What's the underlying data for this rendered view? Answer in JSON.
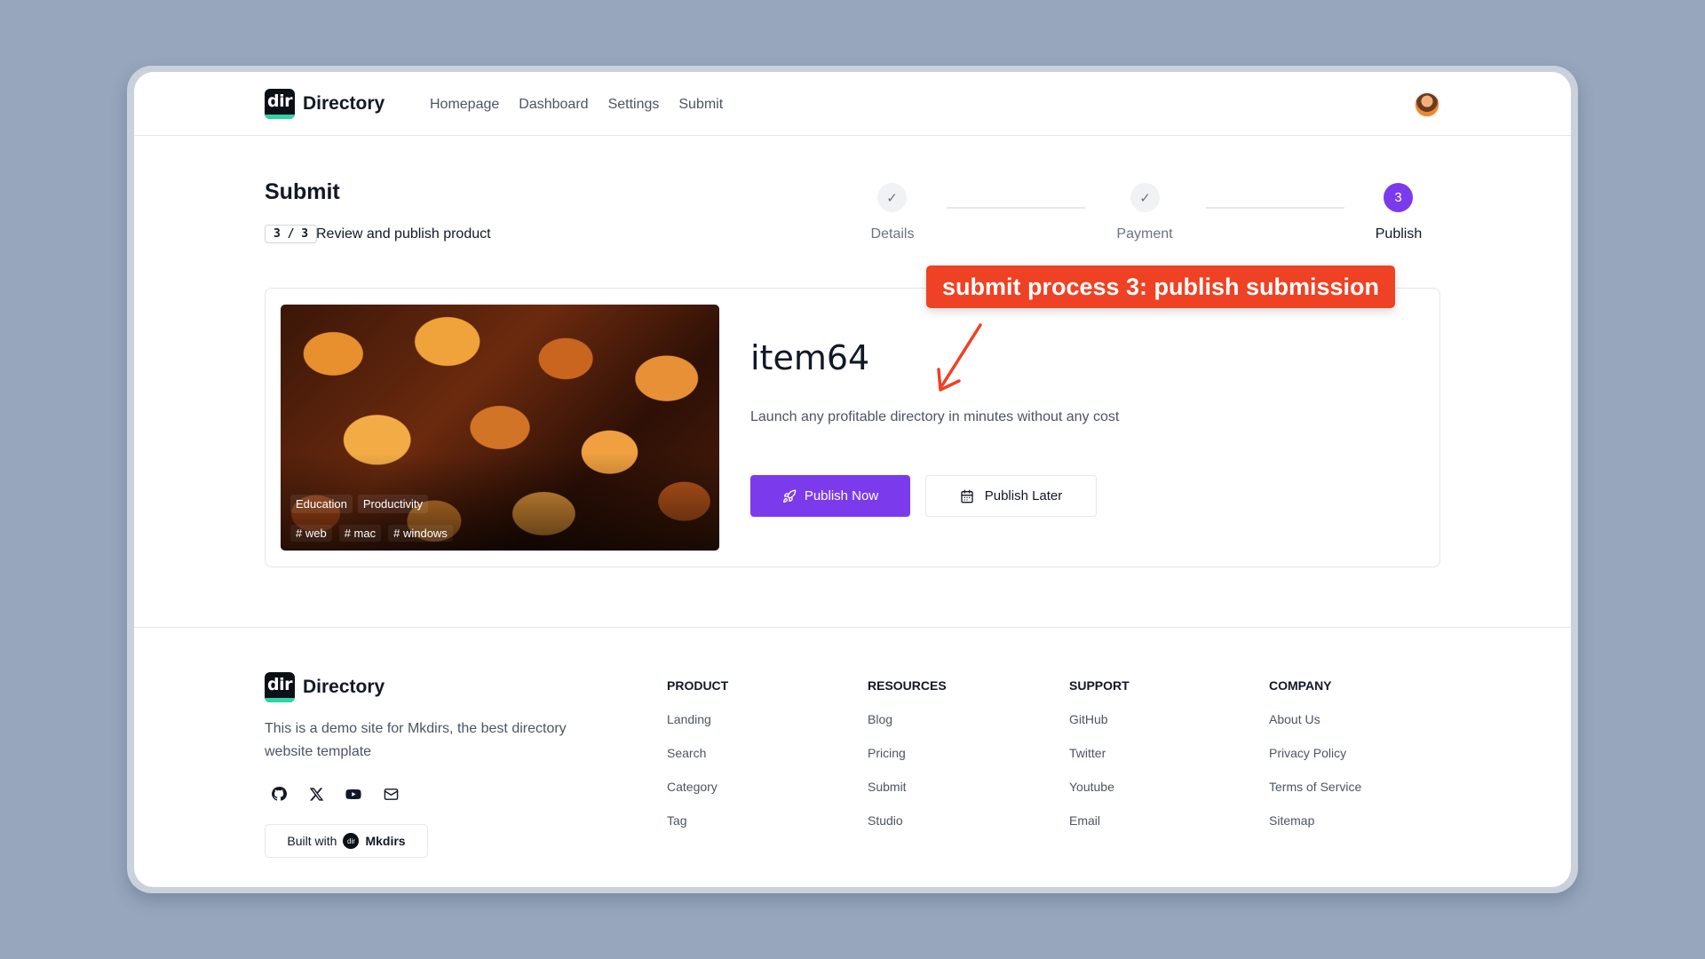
{
  "brand": {
    "logo_text": "dir",
    "name": "Directory"
  },
  "nav": {
    "items": [
      "Homepage",
      "Dashboard",
      "Settings",
      "Submit"
    ]
  },
  "page": {
    "title": "Submit",
    "step_badge": "3 / 3",
    "step_description": "Review and publish product"
  },
  "stepper": {
    "steps": [
      {
        "label": "Details",
        "state": "done"
      },
      {
        "label": "Payment",
        "state": "done"
      },
      {
        "label": "Publish",
        "number": "3",
        "state": "active"
      }
    ]
  },
  "annotation": {
    "text": "submit process 3: publish submission",
    "color": "#ef4123"
  },
  "item": {
    "name": "item64",
    "description": "Launch any profitable directory in minutes without any cost",
    "categories": [
      "Education",
      "Productivity"
    ],
    "tags": [
      "# web",
      "# mac",
      "# windows"
    ]
  },
  "actions": {
    "publish_now": "Publish Now",
    "publish_later": "Publish Later"
  },
  "footer": {
    "description": "This is a demo site for Mkdirs, the best directory website template",
    "built_with_prefix": "Built with",
    "built_with_name": "Mkdirs",
    "columns": [
      {
        "heading": "PRODUCT",
        "links": [
          "Landing",
          "Search",
          "Category",
          "Tag"
        ]
      },
      {
        "heading": "RESOURCES",
        "links": [
          "Blog",
          "Pricing",
          "Submit",
          "Studio"
        ]
      },
      {
        "heading": "SUPPORT",
        "links": [
          "GitHub",
          "Twitter",
          "Youtube",
          "Email"
        ]
      },
      {
        "heading": "COMPANY",
        "links": [
          "About Us",
          "Privacy Policy",
          "Terms of Service",
          "Sitemap"
        ]
      }
    ],
    "social_icons": [
      "github-icon",
      "x-icon",
      "youtube-icon",
      "mail-icon"
    ]
  },
  "colors": {
    "accent": "#7c3aed",
    "brand_bar": "#2dd4a7",
    "background": "#97a6bc"
  }
}
